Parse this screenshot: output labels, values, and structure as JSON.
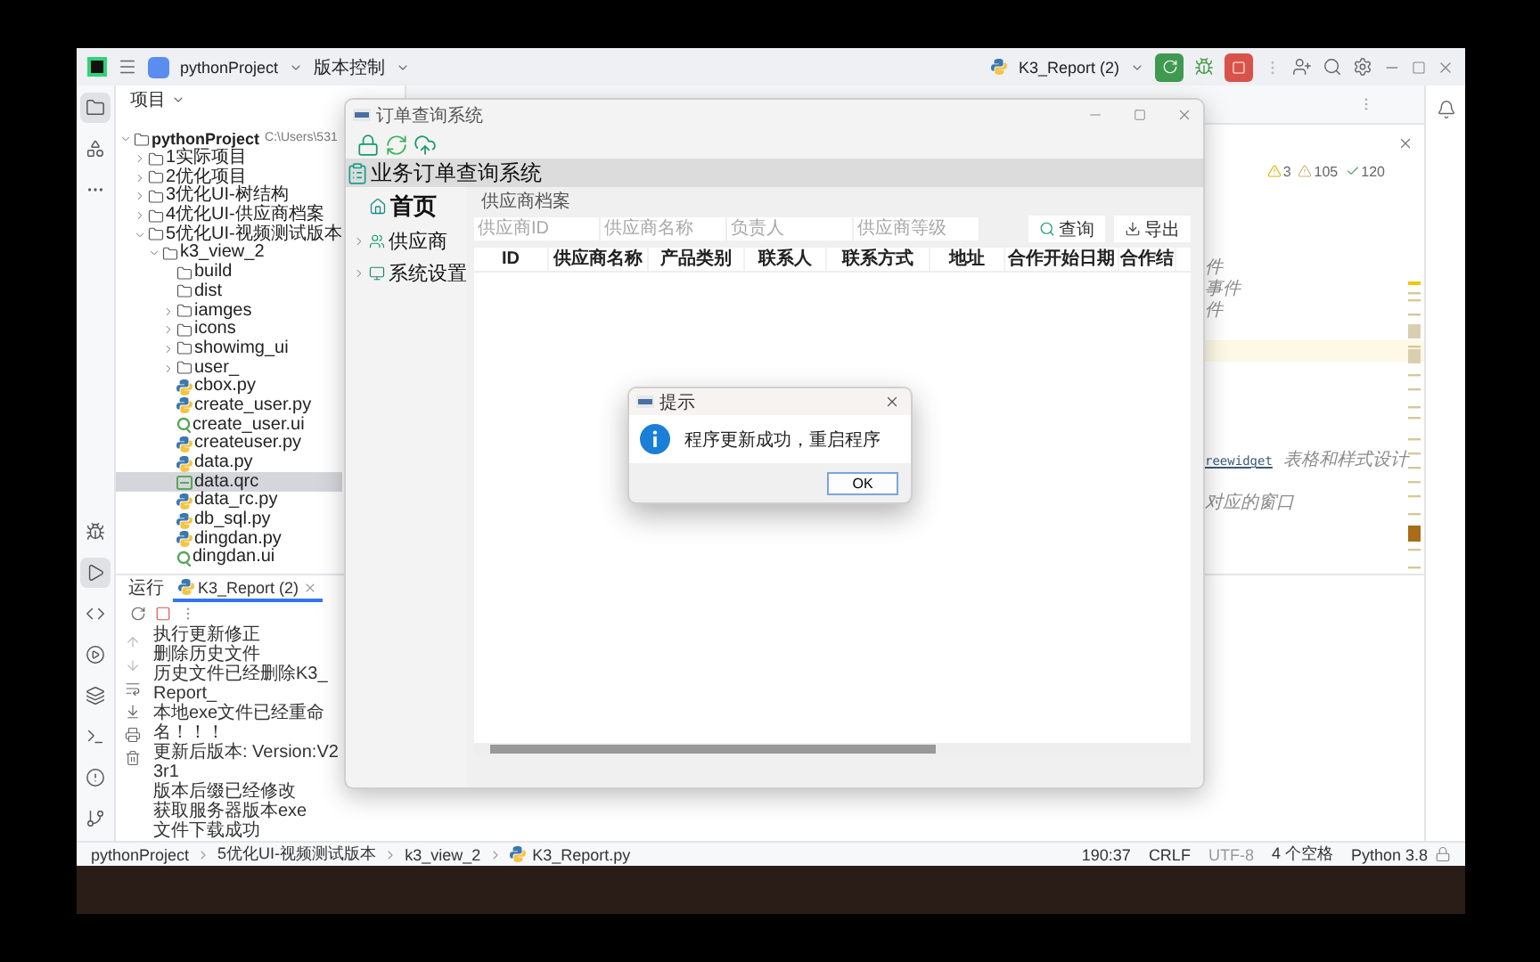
{
  "ide": {
    "toolbar": {
      "project": "pythonProject",
      "vcs": "版本控制",
      "run_config": "K3_Report (2)"
    },
    "tool_strip": {
      "top": [
        {
          "kind": "project",
          "active": true
        },
        {
          "kind": "structure",
          "active": false
        },
        {
          "kind": "more",
          "active": false
        }
      ],
      "bottom": [
        {
          "kind": "debug",
          "active": false
        },
        {
          "kind": "run",
          "active": true
        },
        {
          "kind": "python",
          "active": false
        },
        {
          "kind": "services",
          "active": false
        },
        {
          "kind": "layers",
          "active": false
        },
        {
          "kind": "terminal",
          "active": false
        },
        {
          "kind": "problems",
          "active": false
        },
        {
          "kind": "git",
          "active": false
        }
      ]
    },
    "project_panel": {
      "title": "项目",
      "tree": [
        {
          "name": "pythonProject",
          "path": "C:\\Users\\531",
          "kind": "folder",
          "expanded": true,
          "selected": false,
          "children": [
            {
              "name": "1实际项目",
              "kind": "folder",
              "expanded": false,
              "selected": false
            },
            {
              "name": "2优化项目",
              "kind": "folder",
              "expanded": false,
              "selected": false
            },
            {
              "name": "3优化UI-树结构",
              "kind": "folder",
              "expanded": false,
              "selected": false
            },
            {
              "name": "4优化UI-供应商档案",
              "kind": "folder",
              "expanded": false,
              "selected": false
            },
            {
              "name": "5优化UI-视频测试版本",
              "kind": "folder",
              "expanded": true,
              "selected": false,
              "children": [
                {
                  "name": "k3_view_2",
                  "kind": "folder",
                  "expanded": true,
                  "selected": false,
                  "children": [
                    {
                      "name": "build",
                      "kind": "dir",
                      "selected": false
                    },
                    {
                      "name": "dist",
                      "kind": "dir",
                      "selected": false
                    },
                    {
                      "name": "iamges",
                      "kind": "folder",
                      "expanded": false,
                      "selected": false
                    },
                    {
                      "name": "icons",
                      "kind": "folder",
                      "expanded": false,
                      "selected": false
                    },
                    {
                      "name": "showimg_ui",
                      "kind": "folder",
                      "expanded": false,
                      "selected": false
                    },
                    {
                      "name": "user_",
                      "kind": "folder",
                      "expanded": false,
                      "selected": false
                    },
                    {
                      "name": "cbox.py",
                      "kind": "py",
                      "selected": false
                    },
                    {
                      "name": "create_user.py",
                      "kind": "py",
                      "selected": false
                    },
                    {
                      "name": "create_user.ui",
                      "kind": "ui",
                      "selected": false
                    },
                    {
                      "name": "createuser.py",
                      "kind": "py",
                      "selected": false
                    },
                    {
                      "name": "data.py",
                      "kind": "py",
                      "selected": false
                    },
                    {
                      "name": "data.qrc",
                      "kind": "qrc",
                      "selected": true
                    },
                    {
                      "name": "data_rc.py",
                      "kind": "py",
                      "selected": false
                    },
                    {
                      "name": "db_sql.py",
                      "kind": "py",
                      "selected": false
                    },
                    {
                      "name": "dingdan.py",
                      "kind": "py",
                      "selected": false
                    },
                    {
                      "name": "dingdan.ui",
                      "kind": "ui",
                      "selected": false
                    }
                  ]
                }
              ]
            }
          ]
        }
      ]
    },
    "editor": {
      "inspections": [
        {
          "kind": "error",
          "count": "3"
        },
        {
          "kind": "warning",
          "count": "105"
        },
        {
          "kind": "ok",
          "count": "120"
        }
      ],
      "lines": [
        {
          "comment": "件"
        },
        {
          "comment": "事件"
        },
        {
          "comment": "件"
        },
        {
          "code": "reewidget",
          "comment": "表格和样式设计"
        },
        {
          "comment": "对应的窗口"
        }
      ]
    },
    "run_panel": {
      "tabs": [
        {
          "label": "运行",
          "selected": false
        },
        {
          "label": "K3_Report (2)",
          "selected": true
        }
      ],
      "output": [
        "执行更新修正",
        "删除历史文件",
        "历史文件已经删除K3_Report_",
        "本地exe文件已经重命名！！！",
        "更新后版本: Version:V23r1",
        "版本后缀已经修改",
        "获取服务器版本exe",
        "文件下载成功"
      ]
    },
    "status_bar": {
      "breadcrumb": [
        "pythonProject",
        "5优化UI-视频测试版本",
        "k3_view_2",
        "K3_Report.py"
      ],
      "position": "190:37",
      "line_separator": "CRLF",
      "encoding": "UTF-8",
      "indent": "4 个空格",
      "interpreter": "Python 3.8"
    }
  },
  "app_window": {
    "title": "订单查询系统",
    "header": "业务订单查询系统",
    "nav": [
      {
        "label": "首页",
        "kind": "home"
      },
      {
        "label": "供应商",
        "kind": "group",
        "expanded": false
      },
      {
        "label": "系统设置",
        "kind": "group",
        "expanded": false
      }
    ],
    "group_title": "供应商档案",
    "filters": [
      {
        "placeholder": "供应商ID"
      },
      {
        "placeholder": "供应商名称"
      },
      {
        "placeholder": "负责人"
      },
      {
        "placeholder": "供应商等级"
      }
    ],
    "buttons": [
      {
        "label": "查询",
        "kind": "search"
      },
      {
        "label": "导出",
        "kind": "export"
      }
    ],
    "columns": [
      "ID",
      "供应商名称",
      "产品类别",
      "联系人",
      "联系方式",
      "地址",
      "合作开始日期",
      "合作结"
    ]
  },
  "dialog": {
    "title": "提示",
    "message": "程序更新成功，重启程序",
    "button": "OK"
  }
}
